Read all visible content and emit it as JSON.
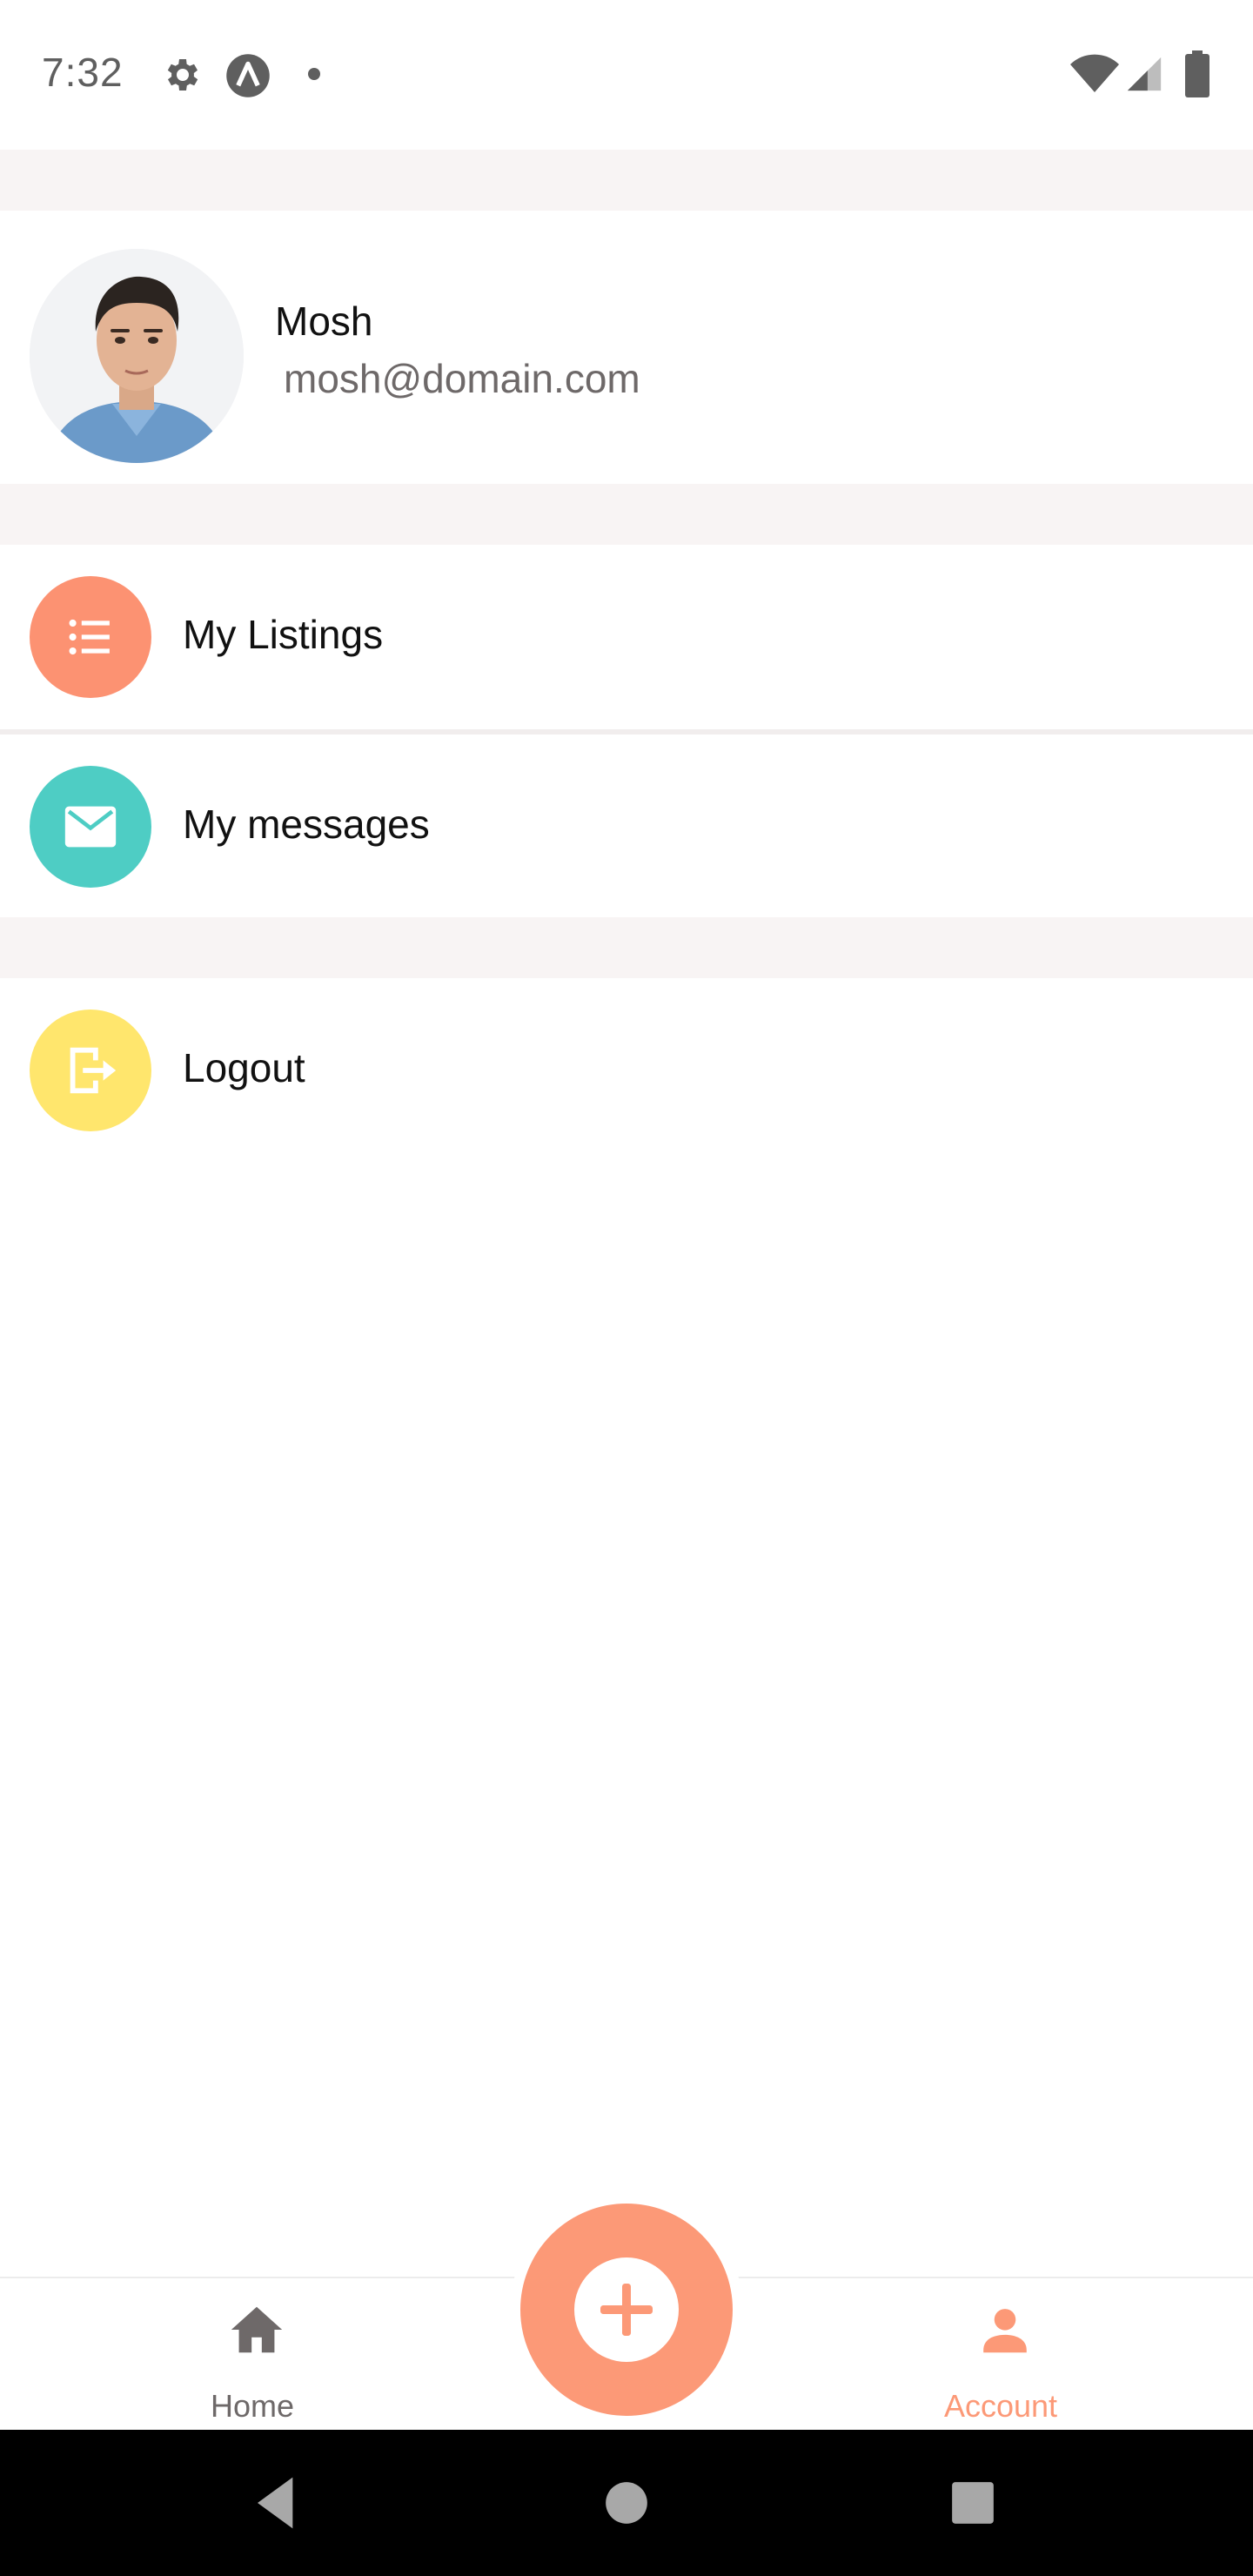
{
  "status_bar": {
    "time": "7:32",
    "icons": [
      "settings-icon",
      "expo-icon",
      "dot-icon",
      "wifi-icon",
      "signal-icon",
      "battery-icon"
    ]
  },
  "profile": {
    "name": "Mosh",
    "email": "mosh@domain.com",
    "avatar_icon": "avatar-photo"
  },
  "menu": {
    "items": [
      {
        "label": "My Listings",
        "icon": "format-list-bulleted-icon",
        "color": "#fc9272"
      },
      {
        "label": "My messages",
        "icon": "email-icon",
        "color": "#4ecdc4"
      }
    ],
    "logout": {
      "label": "Logout",
      "icon": "logout-icon",
      "color": "#ffe66d"
    }
  },
  "tabs": [
    {
      "label": "Home",
      "icon": "home-icon",
      "active": false
    },
    {
      "label": "Account",
      "icon": "account-icon",
      "active": true
    }
  ],
  "fab": {
    "icon": "plus-circle-icon"
  },
  "colors": {
    "primary": "#fc9977",
    "secondary": "#4ecdc4",
    "tertiary": "#ffe66d",
    "light_bg": "#f8f4f4",
    "inactive_tab": "#6e6969"
  },
  "nav_bar": {
    "icons": [
      "back-icon",
      "home-circle-icon",
      "recents-icon"
    ]
  }
}
